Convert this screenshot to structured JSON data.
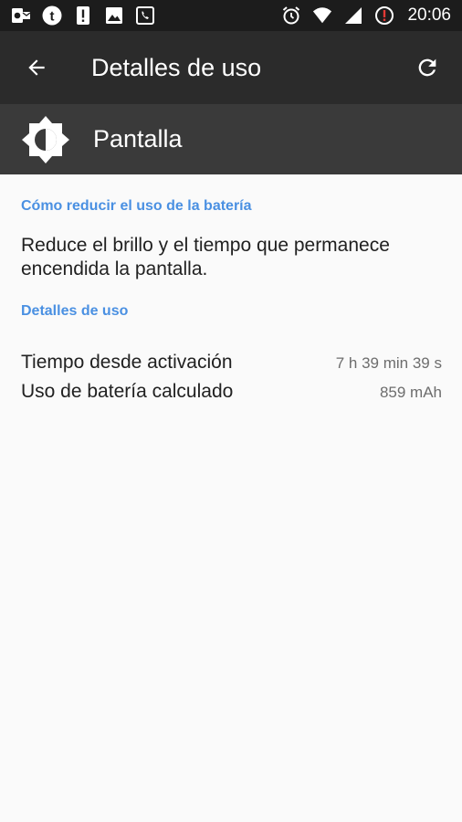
{
  "status_bar": {
    "time": "20:06",
    "left_icons": [
      "outlook-icon",
      "tumblr-icon",
      "alert-icon",
      "image-icon",
      "phone-app-icon"
    ],
    "right_icons": [
      "alarm-icon",
      "wifi-icon",
      "signal-icon",
      "battery-alert-icon"
    ]
  },
  "toolbar": {
    "title": "Detalles de uso",
    "back_icon": "arrow-back-icon",
    "refresh_icon": "refresh-icon"
  },
  "app": {
    "name": "Pantalla",
    "icon": "brightness-icon"
  },
  "tips": {
    "heading": "Cómo reducir el uso de la batería",
    "text": "Reduce el brillo y el tiempo que permanece encendida la pantalla."
  },
  "usage": {
    "heading": "Detalles de uso",
    "rows": [
      {
        "label": "Tiempo desde activación",
        "value": "7 h 39 min 39 s"
      },
      {
        "label": "Uso de batería calculado",
        "value": "859 mAh"
      }
    ]
  },
  "colors": {
    "accent": "#4a90e2",
    "toolbar": "#2b2b2b",
    "header": "#3a3a3a",
    "statusbar": "#1c1c1c",
    "background": "#fafafa"
  }
}
